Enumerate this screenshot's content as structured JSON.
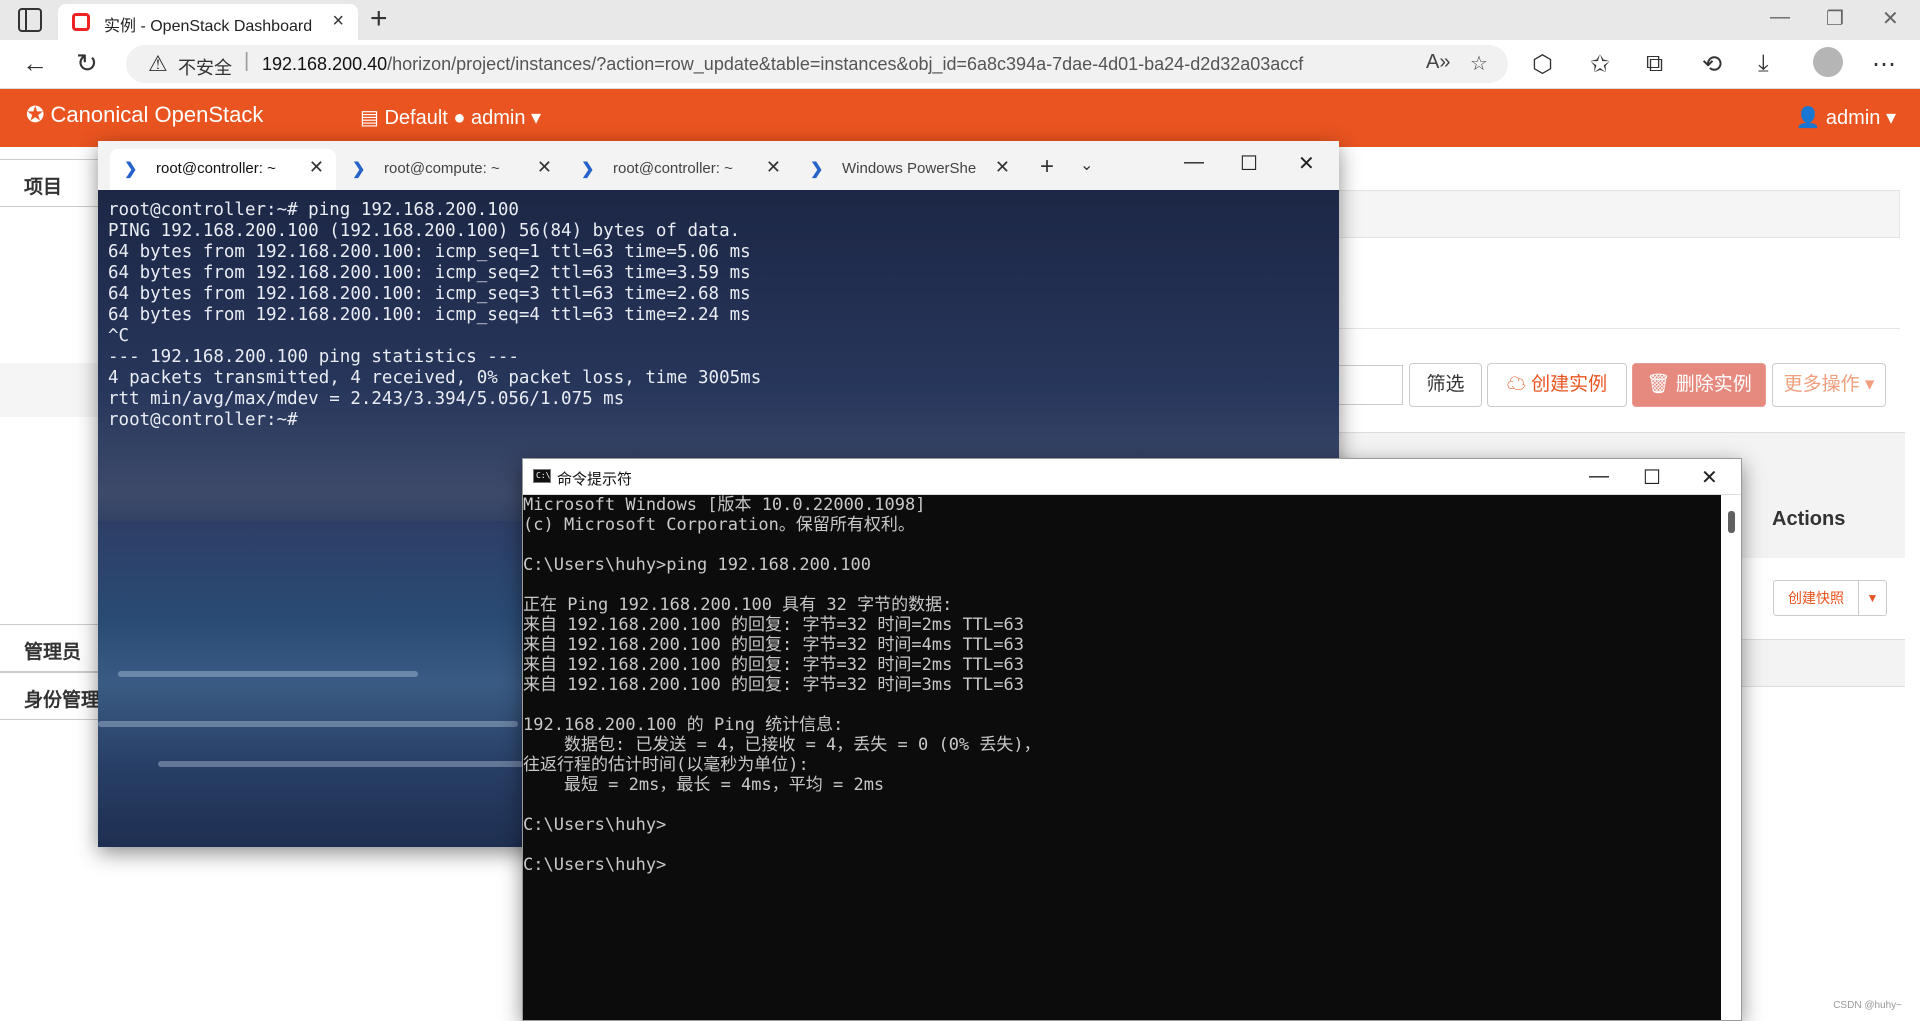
{
  "browser": {
    "tab_title": "实例 - OpenStack Dashboard",
    "tab_close": "×",
    "new_tab": "+",
    "insecure_label": "不安全",
    "url_host": "192.168.200.40",
    "url_rest": "/horizon/project/instances/?action=row_update&table=instances&obj_id=6a8c394a-7dae-4d01-ba24-d2d32a03accf"
  },
  "openstack": {
    "logo": "Canonical OpenStack",
    "project_selector": "Default ● admin ▾",
    "user_menu": "admin ▾",
    "sidebar": {
      "project": "项目",
      "admin": "管理员",
      "identity": "身份管理"
    },
    "buttons": {
      "filter": "筛选",
      "create": "创建实例",
      "delete": "删除实例",
      "more": "更多操作 ▾"
    },
    "table": {
      "actions_header": "Actions",
      "snapshot_button": "创建快照"
    },
    "watermark": "CSDN @huhy~"
  },
  "terminal": {
    "tabs": [
      {
        "label": "root@controller: ~"
      },
      {
        "label": "root@compute: ~"
      },
      {
        "label": "root@controller: ~"
      },
      {
        "label": "Windows PowerShe"
      }
    ],
    "output": "root@controller:~# ping 192.168.200.100\nPING 192.168.200.100 (192.168.200.100) 56(84) bytes of data.\n64 bytes from 192.168.200.100: icmp_seq=1 ttl=63 time=5.06 ms\n64 bytes from 192.168.200.100: icmp_seq=2 ttl=63 time=3.59 ms\n64 bytes from 192.168.200.100: icmp_seq=3 ttl=63 time=2.68 ms\n64 bytes from 192.168.200.100: icmp_seq=4 ttl=63 time=2.24 ms\n^C\n--- 192.168.200.100 ping statistics ---\n4 packets transmitted, 4 received, 0% packet loss, time 3005ms\nrtt min/avg/max/mdev = 2.243/3.394/5.056/1.075 ms\nroot@controller:~#"
  },
  "cmd": {
    "title": "命令提示符",
    "output": "Microsoft Windows [版本 10.0.22000.1098]\n(c) Microsoft Corporation。保留所有权利。\n\nC:\\Users\\huhy>ping 192.168.200.100\n\n正在 Ping 192.168.200.100 具有 32 字节的数据:\n来自 192.168.200.100 的回复: 字节=32 时间=2ms TTL=63\n来自 192.168.200.100 的回复: 字节=32 时间=4ms TTL=63\n来自 192.168.200.100 的回复: 字节=32 时间=2ms TTL=63\n来自 192.168.200.100 的回复: 字节=32 时间=3ms TTL=63\n\n192.168.200.100 的 Ping 统计信息:\n    数据包: 已发送 = 4，已接收 = 4，丢失 = 0 (0% 丢失)，\n往返行程的估计时间(以毫秒为单位):\n    最短 = 2ms，最长 = 4ms，平均 = 2ms\n\nC:\\Users\\huhy>\n\nC:\\Users\\huhy>"
  },
  "colors": {
    "brand": "#e95420",
    "terminal_bg": "#1f2d4d",
    "cmd_bg": "#0c0c0c"
  }
}
